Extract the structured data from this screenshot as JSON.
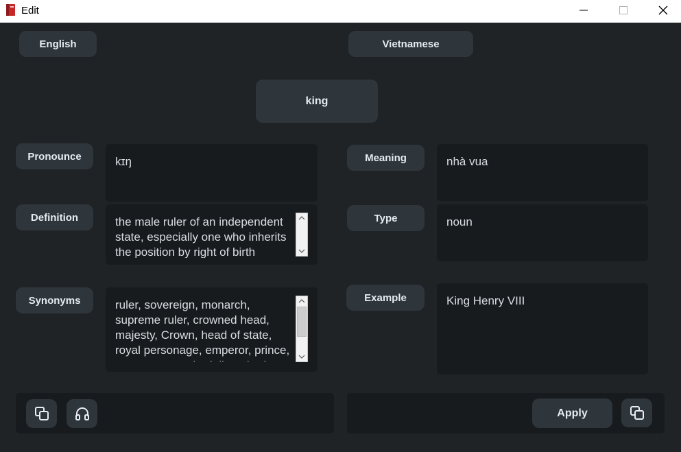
{
  "window": {
    "title": "Edit",
    "app_icon": "red-book-icon",
    "controls": [
      "minimize-icon",
      "maximize-icon",
      "close-icon"
    ]
  },
  "languages": {
    "source": "English",
    "target": "Vietnamese"
  },
  "word": "king",
  "fields": {
    "pronounce": {
      "label": "Pronounce",
      "value": "kɪŋ"
    },
    "definition": {
      "label": "Definition",
      "value": "the male ruler of an independent state, especially one who inherits the position by right of birth"
    },
    "synonyms": {
      "label": "Synonyms",
      "value": "ruler, sovereign, monarch, supreme ruler, crowned head, majesty, Crown, head of state, royal personage, emperor, prince, potentate, overlord, liege lord"
    },
    "meaning": {
      "label": "Meaning",
      "value": "nhà vua"
    },
    "type": {
      "label": "Type",
      "value": "noun"
    },
    "example": {
      "label": "Example",
      "value": "King Henry VIII"
    }
  },
  "actions": {
    "apply_label": "Apply",
    "icons": [
      "copy-icon",
      "headphones-icon",
      "copy-icon"
    ]
  },
  "colors": {
    "background": "#1f2326",
    "button": "#2e353b",
    "field": "#181b1e",
    "text": "#e4ecf2"
  }
}
